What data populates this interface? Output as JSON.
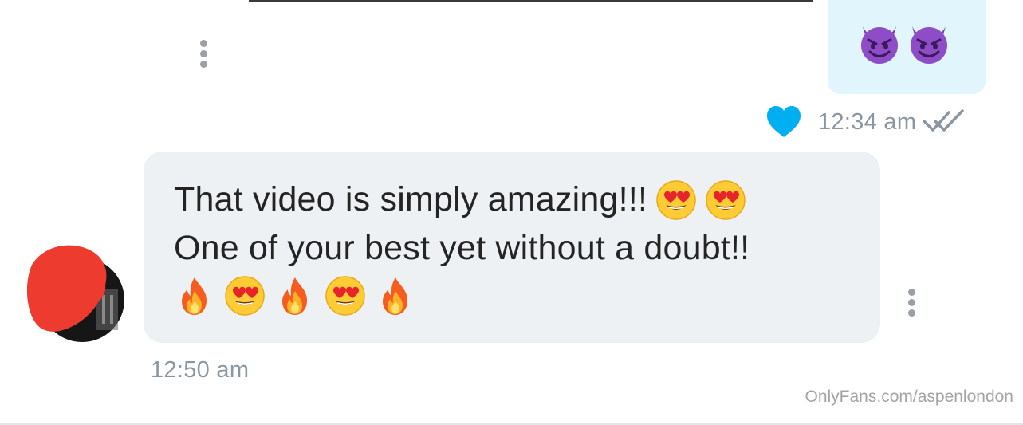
{
  "thread": {
    "sent_message": {
      "emojis": [
        "smiling-face-with-horns",
        "smiling-face-with-horns"
      ],
      "time": "12:34 am",
      "liked": true,
      "read_status": "read"
    },
    "received_message": {
      "line1": "That video is simply amazing!!!",
      "line2": "One of your best yet without a doubt!!",
      "line1_emojis": [
        "heart-eyes",
        "heart-eyes"
      ],
      "line3_emojis": [
        "fire",
        "heart-eyes",
        "fire",
        "heart-eyes",
        "fire"
      ],
      "time": "12:50 am"
    }
  },
  "watermark": "OnlyFans.com/aspenlondon",
  "colors": {
    "sent_bubble": "#e1f5fc",
    "received_bubble": "#eef1f3",
    "heart": "#00aff0",
    "timestamp": "#8a96a0",
    "avatar_redaction": "#ee3b2f"
  }
}
